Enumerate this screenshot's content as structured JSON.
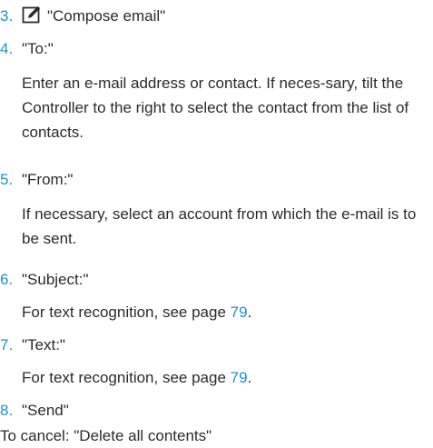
{
  "steps": [
    {
      "num": "3.",
      "label": "\"Compose email\"",
      "icon": "compose-icon"
    },
    {
      "num": "4.",
      "label": "\"To:\"",
      "desc": "Enter an e-mail address or contact. If neces-sary, tilt the Controller to the right to select the contact from the list of contacts."
    },
    {
      "num": "5.",
      "label": "\"From:\"",
      "desc": "If necessary, select an account from which the e-mail is to be sent."
    },
    {
      "num": "6.",
      "label": "\"Subject:\"",
      "desc_prefix": "For text recognition, see page ",
      "page_ref": "79",
      "desc_suffix": "."
    },
    {
      "num": "7.",
      "label": "\"Text:\"",
      "desc_prefix": "For text recognition, see page ",
      "page_ref": "79",
      "desc_suffix": "."
    },
    {
      "num": "8.",
      "label": "\"Send\""
    }
  ],
  "footer": "To cancel: \"Delete all contents\"",
  "colors": {
    "accent": "#1f8fd0",
    "text": "#2b2b2b"
  }
}
